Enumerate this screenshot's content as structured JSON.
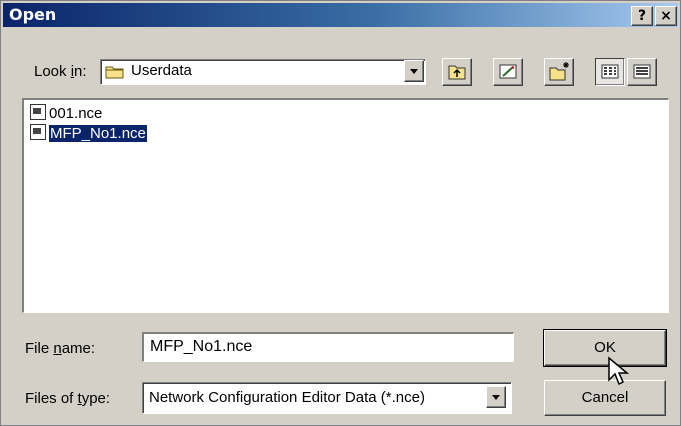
{
  "window": {
    "title": "Open",
    "help_button": "?",
    "close_button": "×"
  },
  "look_in": {
    "label_pre": "Look ",
    "label_accel": "i",
    "label_post": "n:",
    "value": "Userdata"
  },
  "toolbar": {
    "buttons": [
      "up-one-level",
      "desktop",
      "create-new-folder",
      "list-view",
      "details-view"
    ]
  },
  "files": [
    {
      "name": "001.nce",
      "selected": false
    },
    {
      "name": "MFP_No1.nce",
      "selected": true
    }
  ],
  "file_name": {
    "label_pre": "File ",
    "label_accel": "n",
    "label_post": "ame:",
    "value": "MFP_No1.nce"
  },
  "file_type": {
    "label_pre": "Files of ",
    "label_accel": "t",
    "label_post": "ype:",
    "value": "Network Configuration Editor Data (*.nce)"
  },
  "buttons": {
    "ok": "OK",
    "cancel": "Cancel"
  },
  "colors": {
    "title_start": "#0a246a",
    "title_end": "#a6caf0",
    "face": "#d4d0c8",
    "selection": "#0a246a"
  }
}
